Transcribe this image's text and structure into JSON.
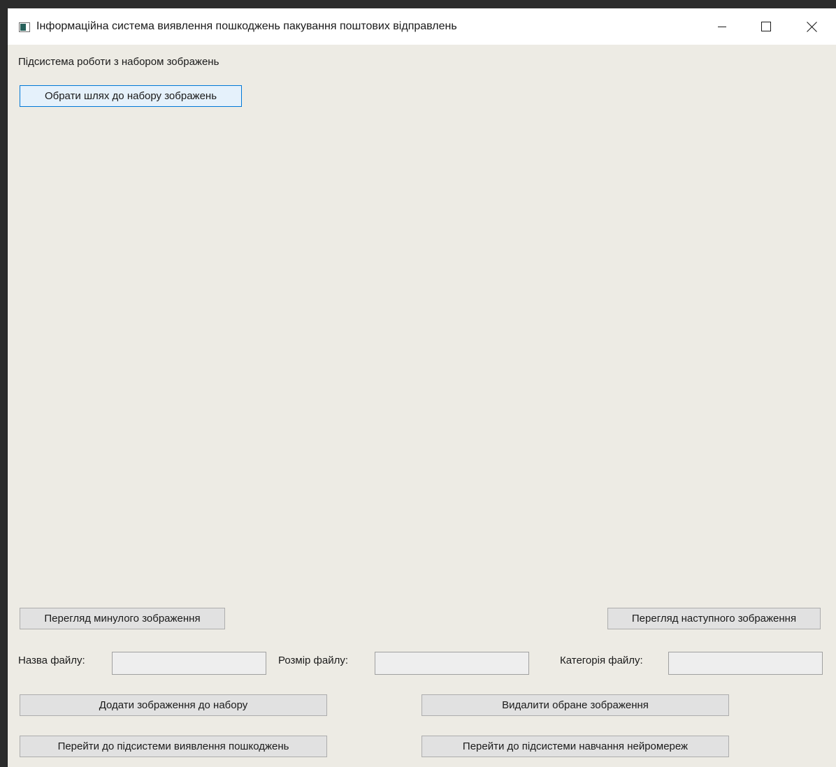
{
  "window": {
    "title": "Інформаційна система виявлення пошкоджень пакування поштових відправлень"
  },
  "subsystem": {
    "label": "Підсистема роботи з набором зображень"
  },
  "buttons": {
    "select_path": "Обрати шлях до набору зображень",
    "prev_image": "Перегляд минулого зображення",
    "next_image": "Перегляд наступного зображення",
    "add_image": "Додати зображення до набору",
    "delete_image": "Видалити обране зображення",
    "goto_detection": "Перейти до підсистеми виявлення пошкоджень",
    "goto_training": "Перейти до підсистеми навчання нейромереж"
  },
  "fields": {
    "file_name": {
      "label": "Назва файлу:",
      "value": ""
    },
    "file_size": {
      "label": "Розмір файлу:",
      "value": ""
    },
    "file_category": {
      "label": "Категорія файлу:",
      "value": ""
    }
  },
  "icons": {
    "app": "app-window-icon",
    "minimize": "minimize-icon",
    "maximize": "maximize-icon",
    "close": "close-icon"
  }
}
